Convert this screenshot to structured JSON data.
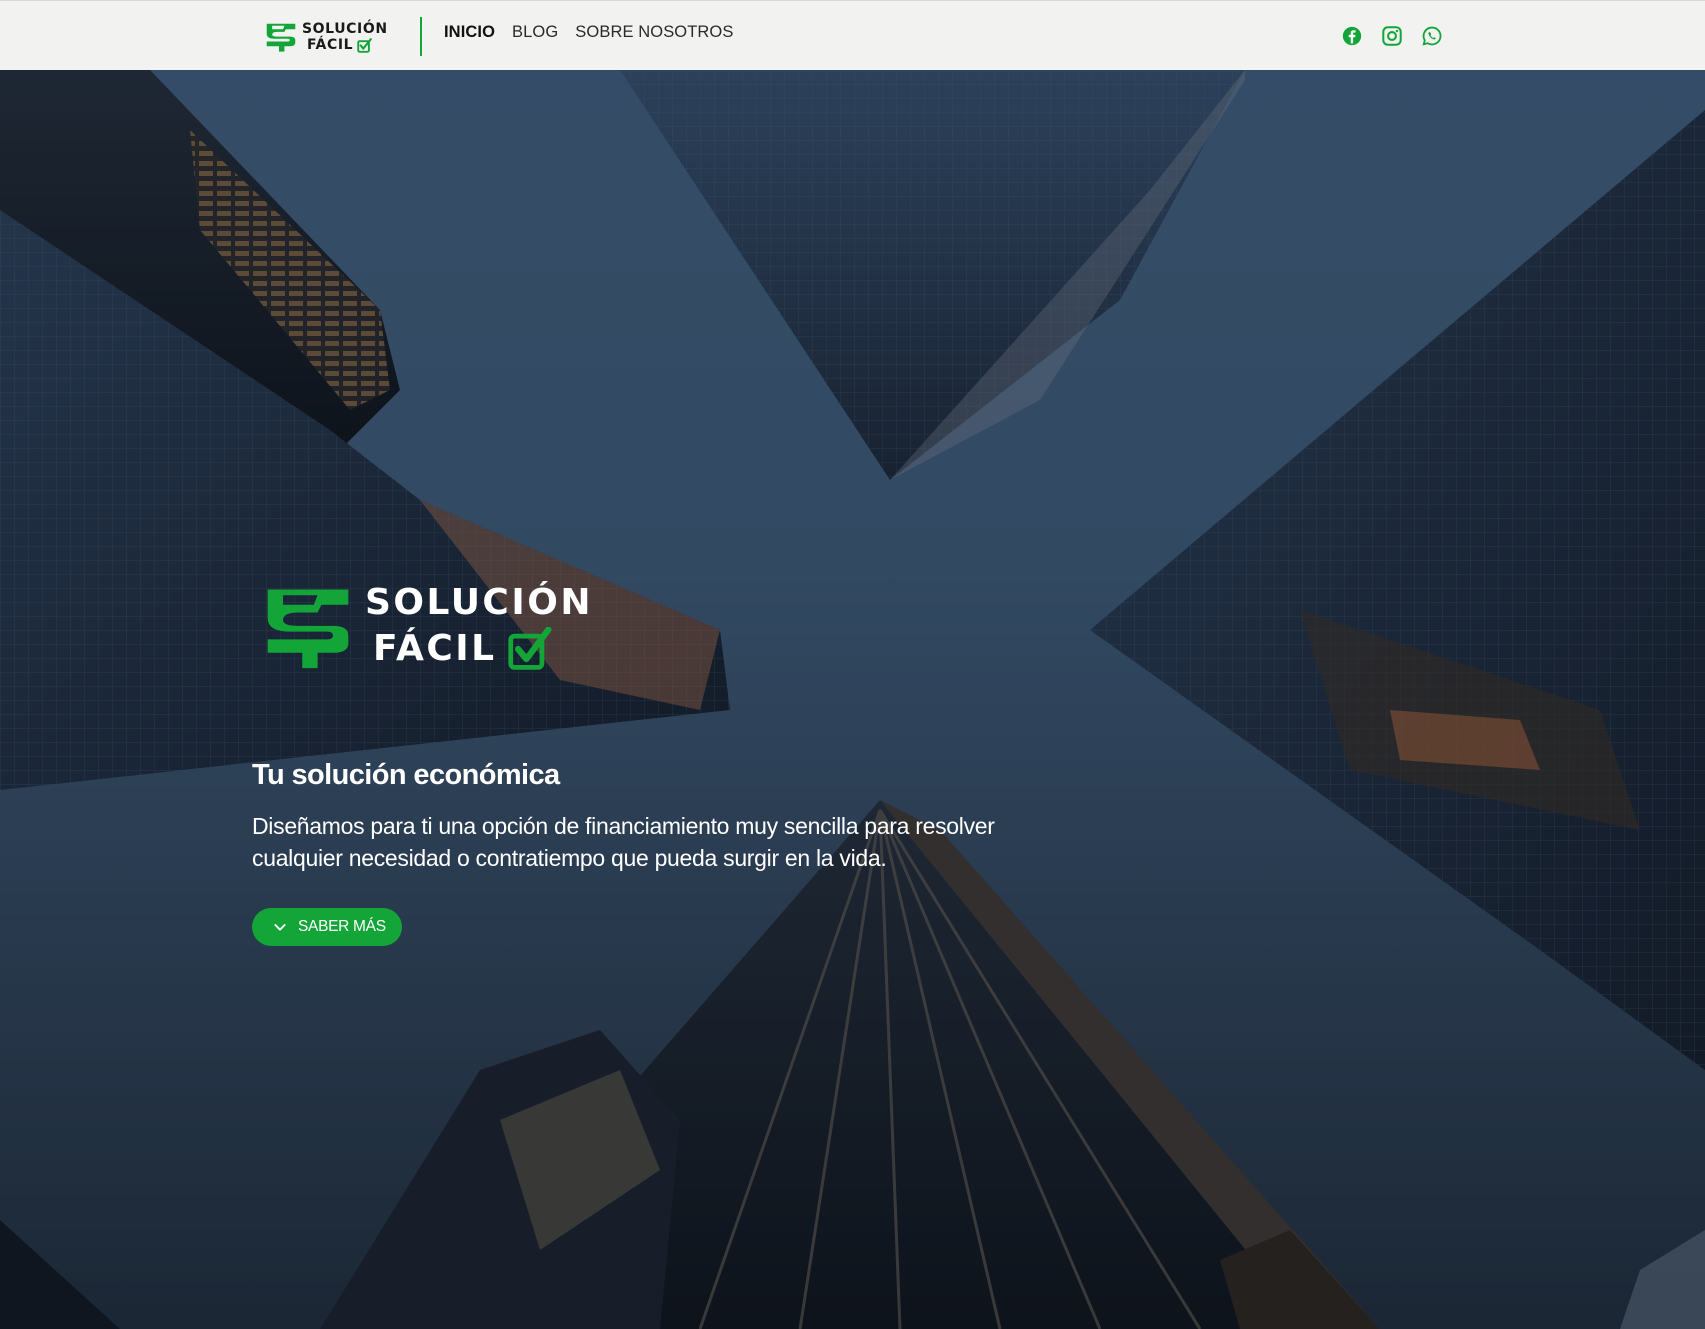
{
  "brand": {
    "name_line1": "SOLUCIÓN",
    "name_line2": "FÁCIL",
    "accent_color": "#13a538"
  },
  "nav": {
    "links": [
      {
        "label": "INICIO",
        "active": true
      },
      {
        "label": "BLOG",
        "active": false
      },
      {
        "label": "SOBRE NOSOTROS",
        "active": false
      }
    ],
    "social": [
      "facebook-icon",
      "instagram-icon",
      "whatsapp-icon"
    ]
  },
  "hero": {
    "title": "Tu solución económica",
    "description": "Diseñamos para ti una opción de financiamiento muy sencilla para resolver cualquier necesidad o contratiempo que pueda surgir en la vida.",
    "cta_label": "SABER MÁS"
  }
}
